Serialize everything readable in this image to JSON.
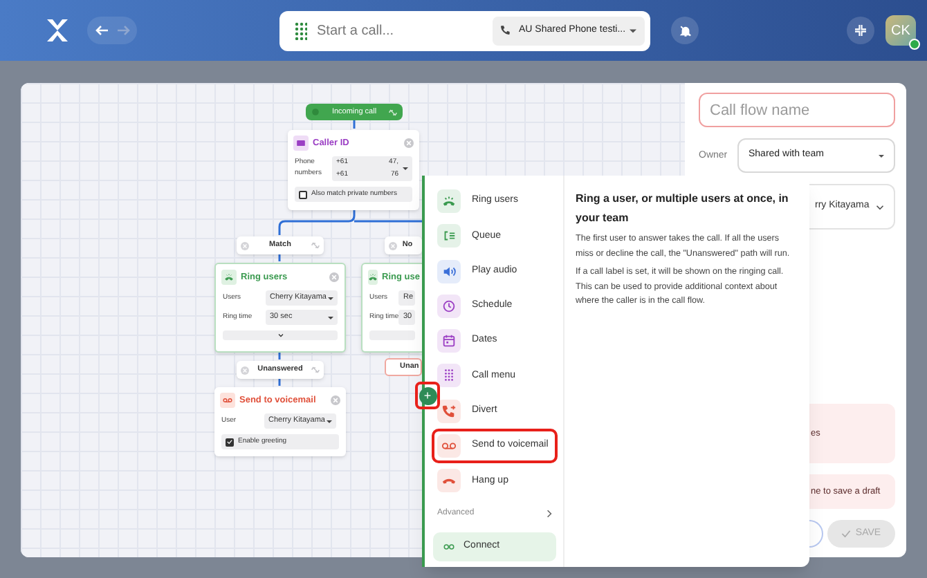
{
  "top_bar": {
    "nav_buttons": [
      {
        "kind": "back",
        "disabled": false
      },
      {
        "kind": "forward",
        "disabled": true
      }
    ],
    "call_search": {
      "placeholder": "Start a call..."
    },
    "phone_selector": "AU Shared Phone testi...",
    "avatar": {
      "initials": "CK",
      "online": true
    }
  },
  "canvas": {
    "trigger": {
      "label": "Incoming call"
    },
    "caller_id": {
      "title": "Caller ID",
      "field_label": "Phone numbers",
      "numbers": [
        {
          "prefix": "+61",
          "suffix": "47,"
        },
        {
          "prefix": "+61",
          "suffix": "76"
        }
      ],
      "private_option": {
        "label": "Also match private numbers",
        "checked": false
      }
    },
    "match_branch": {
      "label": "Match"
    },
    "match_ring_users": {
      "title": "Ring users",
      "fields": [
        {
          "label": "Users",
          "value": "Cherry Kitayama"
        },
        {
          "label": "Ring time",
          "value": "30 sec"
        }
      ]
    },
    "match_unanswered": {
      "label": "Unanswered"
    },
    "voicemail": {
      "title": "Send to voicemail",
      "user_label": "User",
      "user_value": "Cherry Kitayama",
      "greeting": {
        "label": "Enable greeting",
        "checked": true
      }
    },
    "no_branch": {
      "label": "No"
    },
    "no_ring_users": {
      "title": "Ring use",
      "fields": [
        {
          "label": "Users",
          "value": "Re"
        },
        {
          "label": "Ring time",
          "value": "30"
        }
      ]
    },
    "no_unanswered": {
      "label": "Unan"
    },
    "add_button": {
      "label": "+",
      "highlighted": true
    }
  },
  "step_menu": {
    "items": [
      {
        "label": "Ring users",
        "kind": "ring",
        "color": "#3a9a4f",
        "highlighted": false
      },
      {
        "label": "Queue",
        "kind": "queue",
        "color": "#3a9a4f",
        "highlighted": false
      },
      {
        "label": "Play audio",
        "kind": "audio",
        "color": "#3b6fd8",
        "highlighted": false
      },
      {
        "label": "Schedule",
        "kind": "clock",
        "color": "#9b3fc4",
        "highlighted": false
      },
      {
        "label": "Dates",
        "kind": "calendar",
        "color": "#9b3fc4",
        "highlighted": false
      },
      {
        "label": "Call menu",
        "kind": "keypad",
        "color": "#9b3fc4",
        "highlighted": false
      },
      {
        "label": "Divert",
        "kind": "divert",
        "color": "#e0503a",
        "highlighted": false
      },
      {
        "label": "Send to voicemail",
        "kind": "voicemail",
        "color": "#e0503a",
        "highlighted": true
      },
      {
        "label": "Hang up",
        "kind": "hangup",
        "color": "#e0503a",
        "highlighted": false
      }
    ],
    "advanced": "Advanced",
    "connect": "Connect",
    "description": {
      "title": "Ring a user, or multiple users at once, in your team",
      "paragraphs": [
        "The first user to answer takes the call. If all the users miss or decline the call, the \"Unanswered\" path will run.",
        "If a call label is set, it will be shown on the ringing call. This can be used to provide additional context about where the caller is in the call flow."
      ]
    }
  },
  "side_panel": {
    "flow_name": {
      "placeholder": "Call flow name",
      "invalid": true
    },
    "owner": {
      "label": "Owner",
      "value": "Shared with team"
    },
    "assignee": {
      "value": "rry Kitayama"
    },
    "notices": [
      {
        "text": "es"
      },
      {
        "text": "ne to save a draft"
      }
    ],
    "save_button": {
      "label": "SAVE",
      "disabled": true
    }
  }
}
